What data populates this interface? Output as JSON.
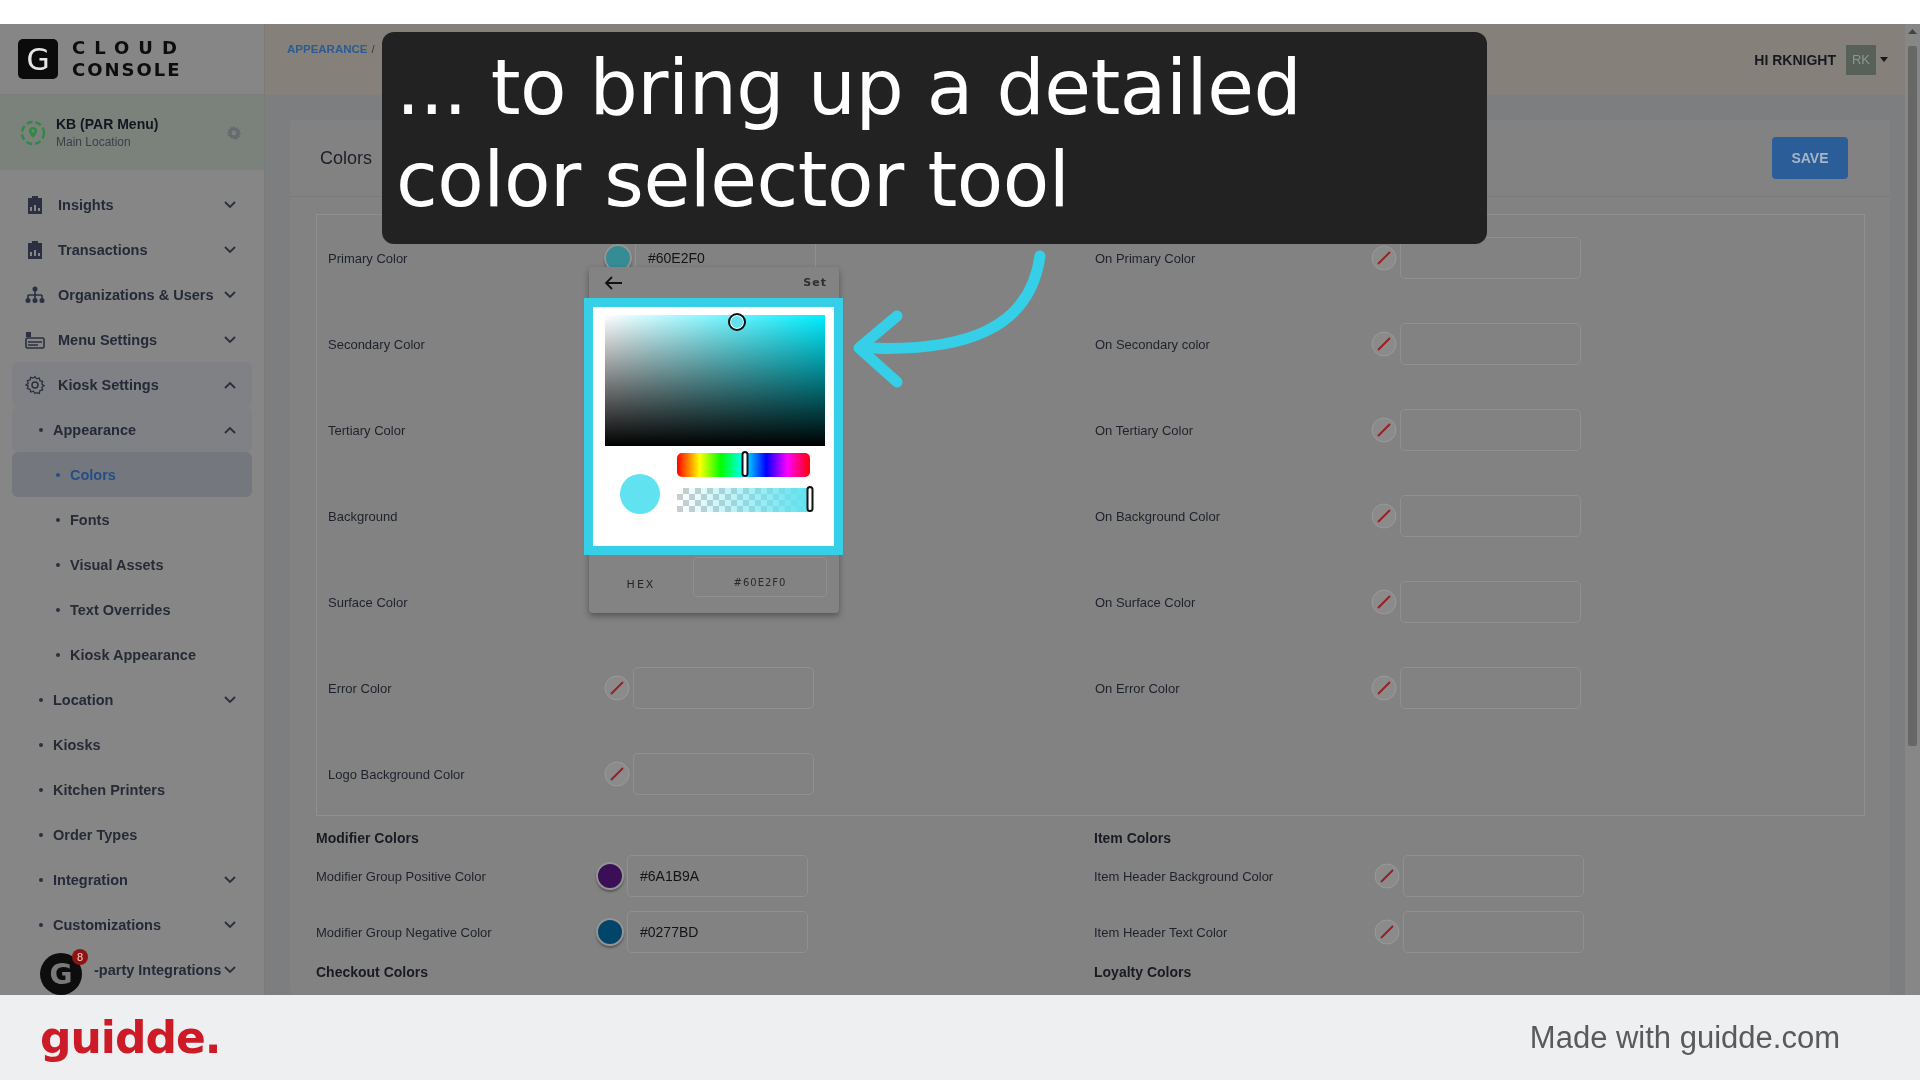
{
  "top_bar": {
    "logo": {
      "mark": "G",
      "line1": "CLOUD",
      "line2": "CONSOLE"
    },
    "breadcrumb": [
      {
        "label": "APPEARANCE",
        "kind": "link"
      },
      {
        "label": "/",
        "kind": "separator"
      }
    ],
    "greeting": "HI RKNIGHT",
    "avatar": "RK"
  },
  "location": {
    "name": "KB (PAR Menu)",
    "subtitle": "Main Location"
  },
  "sidebar": {
    "items": [
      {
        "label": "Insights",
        "kind": "group",
        "expanded": false,
        "selected": false
      },
      {
        "label": "Transactions",
        "kind": "group",
        "expanded": false,
        "selected": false
      },
      {
        "label": "Organizations & Users",
        "kind": "group",
        "expanded": false,
        "selected": false
      },
      {
        "label": "Menu Settings",
        "kind": "group",
        "expanded": false,
        "selected": false
      },
      {
        "label": "Kiosk Settings",
        "kind": "group",
        "expanded": true,
        "selected": false,
        "children": [
          {
            "label": "Appearance",
            "kind": "group",
            "expanded": true,
            "selected": false,
            "children": [
              {
                "label": "Colors",
                "kind": "link",
                "selected": true
              },
              {
                "label": "Fonts",
                "kind": "link",
                "selected": false
              },
              {
                "label": "Visual Assets",
                "kind": "link",
                "selected": false
              },
              {
                "label": "Text Overrides",
                "kind": "link",
                "selected": false
              },
              {
                "label": "Kiosk Appearance",
                "kind": "link",
                "selected": false
              }
            ]
          },
          {
            "label": "Location",
            "kind": "group",
            "expanded": false,
            "selected": false
          },
          {
            "label": "Kiosks",
            "kind": "link",
            "selected": false
          },
          {
            "label": "Kitchen Printers",
            "kind": "link",
            "selected": false
          },
          {
            "label": "Order Types",
            "kind": "link",
            "selected": false
          },
          {
            "label": "Integration",
            "kind": "group",
            "expanded": false,
            "selected": false
          },
          {
            "label": "Customizations",
            "kind": "group",
            "expanded": false,
            "selected": false
          }
        ]
      },
      {
        "label": "-party Integrations",
        "kind": "group",
        "expanded": false,
        "selected": false
      }
    ]
  },
  "page": {
    "title": "Colors",
    "save_button": "SAVE"
  },
  "theme_colors": {
    "left": [
      {
        "label": "Primary Color",
        "kind": "set",
        "color": "#368c95",
        "value": "#60E2F0"
      },
      {
        "label": "Secondary Color",
        "kind": "covered"
      },
      {
        "label": "Tertiary Color",
        "kind": "covered"
      },
      {
        "label": "Background",
        "kind": "covered"
      },
      {
        "label": "Surface Color",
        "kind": "covered"
      },
      {
        "label": "Error Color",
        "kind": "unset"
      },
      {
        "label": "Logo Background Color",
        "kind": "unset"
      }
    ],
    "right": [
      {
        "label": "On Primary Color",
        "kind": "unset"
      },
      {
        "label": "On Secondary color",
        "kind": "unset"
      },
      {
        "label": "On Tertiary Color",
        "kind": "unset"
      },
      {
        "label": "On Background Color",
        "kind": "unset"
      },
      {
        "label": "On Surface Color",
        "kind": "unset"
      },
      {
        "label": "On Error Color",
        "kind": "unset"
      }
    ]
  },
  "modifier_colors": {
    "title": "Modifier Colors",
    "rows": [
      {
        "label": "Modifier Group Positive Color",
        "kind": "set",
        "color": "#3b0f55",
        "value": "#6A1B9A"
      },
      {
        "label": "Modifier Group Negative Color",
        "kind": "set",
        "color": "#02456b",
        "value": "#0277BD"
      }
    ]
  },
  "item_colors": {
    "title": "Item Colors",
    "rows": [
      {
        "label": "Item Header Background Color",
        "kind": "unset"
      },
      {
        "label": "Item Header Text Color",
        "kind": "unset"
      }
    ]
  },
  "checkout_colors": {
    "title": "Checkout Colors"
  },
  "loyalty_colors": {
    "title": "Loyalty Colors"
  },
  "color_picker": {
    "set_button": "Set",
    "preview": {
      "color": "#60e2f0"
    },
    "hue": {
      "level": 0.51
    },
    "alpha": {
      "level": 1
    },
    "hex_label": "HEX",
    "hex_value": "#60E2F0"
  },
  "caption": {
    "text": "... to bring up a detailed color selector tool"
  },
  "chat": {
    "mark": "G",
    "badge": "8"
  },
  "footer": {
    "brand": "guidde.",
    "note": "Made with guidde.com"
  }
}
